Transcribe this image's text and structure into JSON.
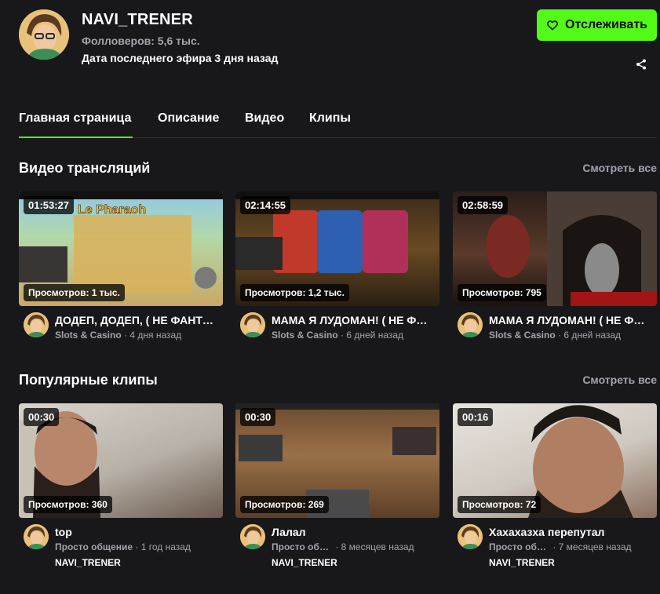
{
  "channel": {
    "name": "NAVI_TRENER",
    "followers": "Фолловеров: 5,6 тыс.",
    "last_stream": "Дата последнего эфира 3 дня назад",
    "follow_label": "Отслеживать",
    "accent": "#53fc18"
  },
  "tabs": [
    {
      "label": "Главная страница",
      "active": true
    },
    {
      "label": "Описание"
    },
    {
      "label": "Видео"
    },
    {
      "label": "Клипы"
    }
  ],
  "videos_section": {
    "title": "Видео трансляций",
    "see_all": "Смотреть все",
    "items": [
      {
        "duration": "01:53:27",
        "views": "Просмотров: 1 тыс.",
        "title": "ДОДЕП, ДОДЕП, ( НЕ ФАНТ…",
        "category": "Slots & Casino",
        "time": " · 4 дня назад"
      },
      {
        "duration": "02:14:55",
        "views": "Просмотров: 1,2 тыс.",
        "title": "МАМА Я ЛУДОМАН! ( НЕ Ф…",
        "category": "Slots & Casino",
        "time": " · 6 дней назад"
      },
      {
        "duration": "02:58:59",
        "views": "Просмотров: 795",
        "title": "МАМА Я ЛУДОМАН! ( НЕ Ф…",
        "category": "Slots & Casino",
        "time": " · 6 дней назад"
      }
    ]
  },
  "clips_section": {
    "title": "Популярные клипы",
    "see_all": "Смотреть все",
    "items": [
      {
        "duration": "00:30",
        "views": "Просмотров: 360",
        "title": "top",
        "category": "Просто общение",
        "time": " · 1 год назад",
        "author": "NAVI_TRENER"
      },
      {
        "duration": "00:30",
        "views": "Просмотров: 269",
        "title": "Лалал",
        "category": "Просто общение",
        "time": " · 8 месяцев назад",
        "author": "NAVI_TRENER"
      },
      {
        "duration": "00:16",
        "views": "Просмотров: 72",
        "title": "Хахахазха перепутал",
        "category": "Просто общение",
        "time": " · 7 месяцев назад",
        "author": "NAVI_TRENER"
      }
    ]
  }
}
